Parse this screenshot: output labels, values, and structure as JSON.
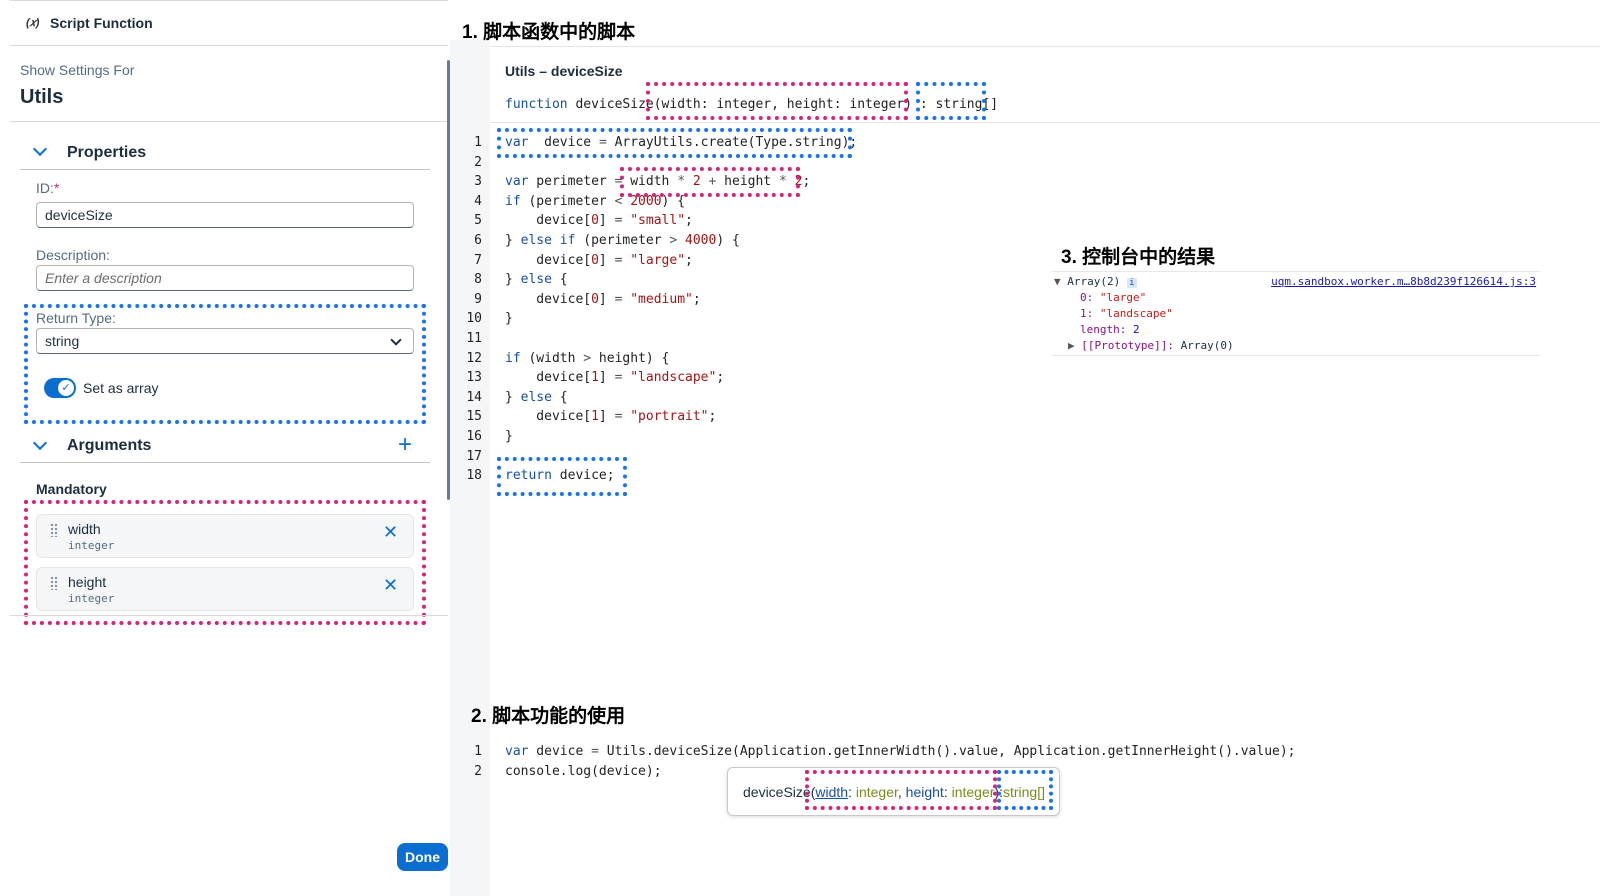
{
  "panel": {
    "icon": "function-icon",
    "title": "Script Function",
    "show_settings_for": "Show Settings For",
    "object_name": "Utils",
    "properties_title": "Properties",
    "id_label": "ID:",
    "required_mark": "*",
    "id_value": "deviceSize",
    "description_label": "Description:",
    "description_placeholder": "Enter a description",
    "return_type_label": "Return Type:",
    "return_type_value": "string",
    "set_as_array_label": "Set as array",
    "set_as_array_checked": true,
    "arguments_title": "Arguments",
    "mandatory_label": "Mandatory",
    "arguments": [
      {
        "name": "width",
        "type": "integer"
      },
      {
        "name": "height",
        "type": "integer"
      }
    ],
    "done_label": "Done"
  },
  "headings": {
    "h1": "1. 脚本函数中的脚本",
    "h2": "2. 脚本功能的使用",
    "h3": "3. 控制台中的结果"
  },
  "editor": {
    "title": "Utils – deviceSize",
    "signature": {
      "keyword": "function",
      "name": "deviceSize",
      "params": "(width: integer, height: integer)",
      "sep": ":",
      "returns": "string[]"
    },
    "line_numbers": [
      "1",
      "2",
      "3",
      "4",
      "5",
      "6",
      "7",
      "8",
      "9",
      "10",
      "11",
      "12",
      "13",
      "14",
      "15",
      "16",
      "17",
      "18"
    ]
  },
  "usage": {
    "line_numbers": [
      "1",
      "2"
    ],
    "tooltip": {
      "name": "deviceSize",
      "open": "(",
      "p1": "width",
      "c1": ": ",
      "t1": "integer",
      "comma": ", ",
      "p2": "height",
      "c2": ": ",
      "t2": "integer",
      "close": "):",
      "returns": "string[]"
    }
  },
  "console": {
    "array_label": "Array(2)",
    "info_badge": "i",
    "source_link": "uqm.sandbox.worker.m…8b8d239f126614.js:3",
    "item0_key": "0",
    "item0_value": "\"large\"",
    "item1_key": "1",
    "item1_value": "\"landscape\"",
    "length_key": "length",
    "length_value": "2",
    "proto_key": "[[Prototype]]",
    "proto_value": "Array(0)"
  },
  "colors": {
    "accent": "#0a6ed1",
    "highlight_pink": "#d1267a",
    "highlight_blue": "#1a73e8"
  }
}
